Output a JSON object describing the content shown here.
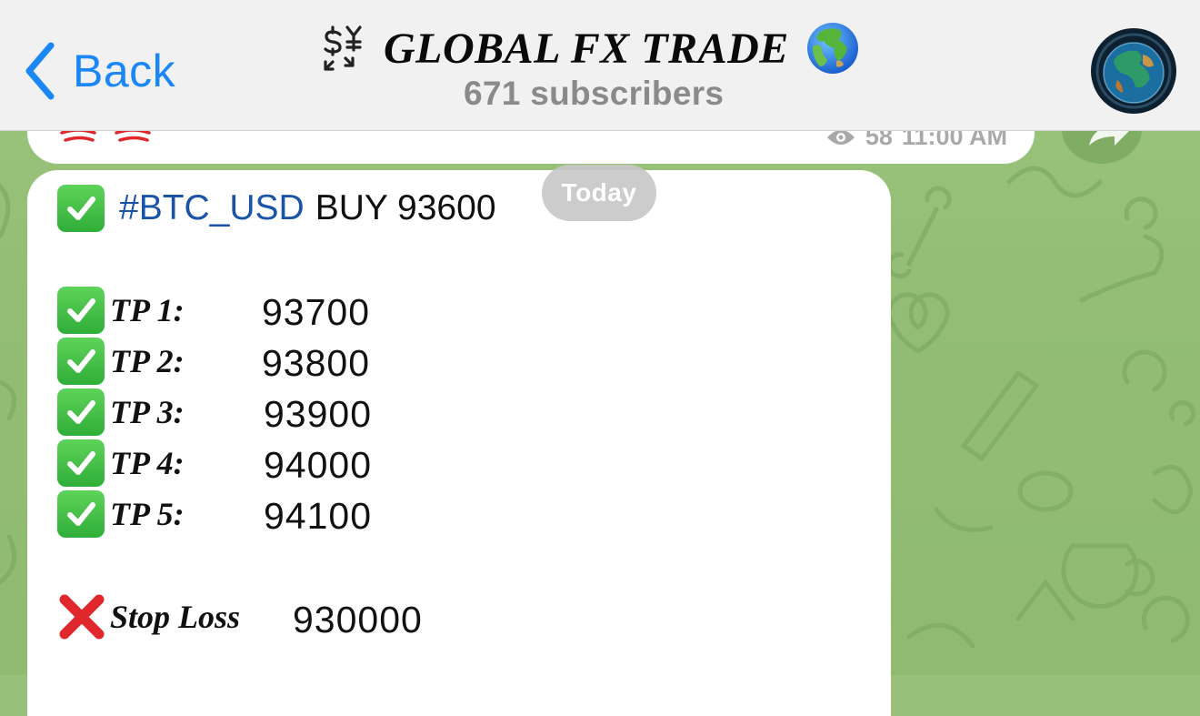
{
  "header": {
    "back_label": "Back",
    "channel_title": "GLOBAL FX TRADE",
    "subscribers": "671 subscribers",
    "title_icon": "currency-exchange-icon",
    "title_emoji": "globe-europe-africa-icon",
    "avatar_icon": "globe-logo"
  },
  "previous_message": {
    "views": "58",
    "time": "11:00 AM"
  },
  "date_badge": "Today",
  "message": {
    "hashtag": "#BTC_USD",
    "direction": "BUY 93600",
    "targets": [
      {
        "label": "TP 1:",
        "value": "93700"
      },
      {
        "label": "TP 2:",
        "value": "93800"
      },
      {
        "label": "TP 3:",
        "value": "93900"
      },
      {
        "label": "TP 4:",
        "value": "94000"
      },
      {
        "label": "TP 5:",
        "value": "94100"
      }
    ],
    "stop_loss_label": "Stop Loss",
    "stop_loss_value": "930000"
  },
  "colors": {
    "accent": "#1b86f5",
    "hashtag": "#1a54a8",
    "wallpaper": "#98c07a",
    "check_green": "#3cba44",
    "cross_red": "#e0272b"
  }
}
